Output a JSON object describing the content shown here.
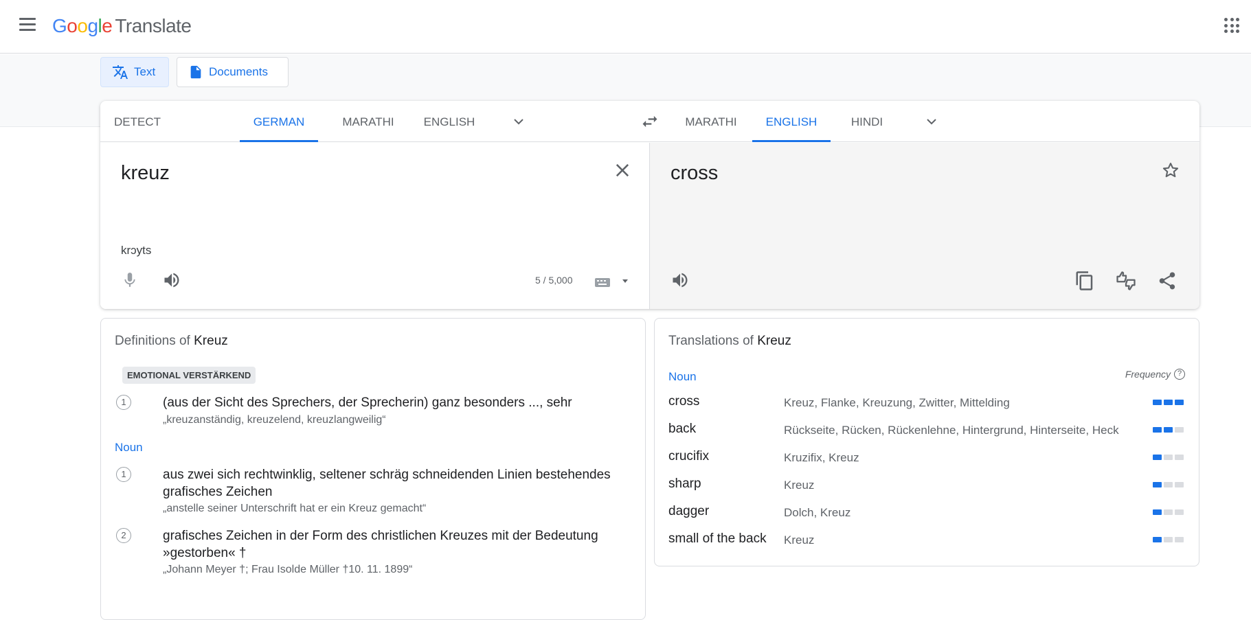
{
  "header": {
    "logo_letters": [
      "G",
      "o",
      "o",
      "g",
      "l",
      "e"
    ],
    "product": "Translate"
  },
  "modes": [
    {
      "label": "Text",
      "active": true
    },
    {
      "label": "Documents",
      "active": false
    }
  ],
  "source_langs": [
    {
      "label": "Detect language",
      "selected": false
    },
    {
      "label": "German",
      "selected": true
    },
    {
      "label": "Marathi",
      "selected": false
    },
    {
      "label": "English",
      "selected": false
    }
  ],
  "target_langs": [
    {
      "label": "Marathi",
      "selected": false
    },
    {
      "label": "English",
      "selected": true
    },
    {
      "label": "Hindi",
      "selected": false
    }
  ],
  "source": {
    "text": "kreuz",
    "transliteration": "krɔyts",
    "char_count": "5 / 5,000"
  },
  "target": {
    "text": "cross"
  },
  "definitions": {
    "title_prefix": "Definitions of",
    "word": "Kreuz",
    "tag": "EMOTIONAL VERSTÄRKEND",
    "first_group": [
      {
        "num": "1",
        "text": "(aus der Sicht des Sprechers, der Sprecherin) ganz besonders ..., sehr",
        "example": "„kreuzanständig, kreuzelend, kreuzlangweilig“"
      }
    ],
    "pos": "Noun",
    "noun_group": [
      {
        "num": "1",
        "text": "aus zwei sich rechtwinklig, seltener schräg schneidenden Linien bestehendes grafisches Zeichen",
        "example": "„anstelle seiner Unterschrift hat er ein Kreuz gemacht“"
      },
      {
        "num": "2",
        "text": "grafisches Zeichen in der Form des christlichen Kreuzes mit der Bedeutung »gestorben« †",
        "example": "„Johann Meyer †; Frau Isolde Müller †10. 11. 1899“"
      }
    ]
  },
  "translations": {
    "title_prefix": "Translations of",
    "word": "Kreuz",
    "pos": "Noun",
    "frequency_label": "Frequency",
    "rows": [
      {
        "word": "cross",
        "synonyms": "Kreuz, Flanke, Kreuzung, Zwitter, Mittelding",
        "frequency": 3
      },
      {
        "word": "back",
        "synonyms": "Rückseite, Rücken, Rückenlehne, Hintergrund, Hinterseite, Heck",
        "frequency": 2
      },
      {
        "word": "crucifix",
        "synonyms": "Kruzifix, Kreuz",
        "frequency": 1
      },
      {
        "word": "sharp",
        "synonyms": "Kreuz",
        "frequency": 1
      },
      {
        "word": "dagger",
        "synonyms": "Dolch, Kreuz",
        "frequency": 1
      },
      {
        "word": "small of the back",
        "synonyms": "Kreuz",
        "frequency": 1
      }
    ]
  },
  "colors": {
    "accent": "#1a73e8",
    "icon": "#5f6368"
  }
}
